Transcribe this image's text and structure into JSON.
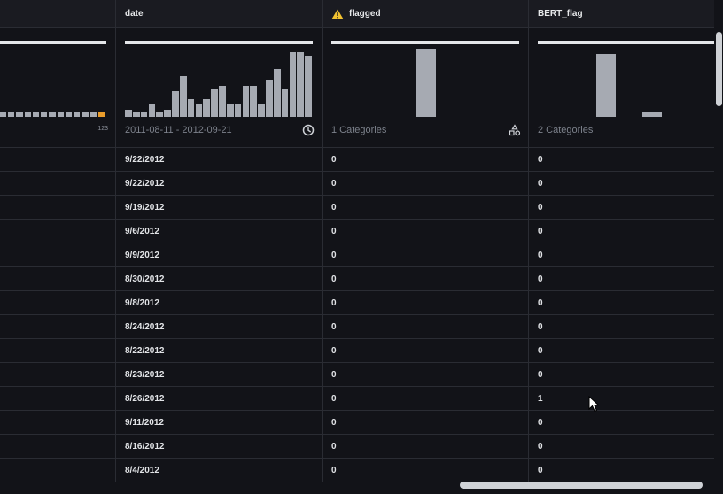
{
  "columns": [
    {
      "key": "prev",
      "header": "",
      "summary": {
        "caption": "",
        "small_caption": "123"
      },
      "cells": [
        "",
        "",
        "",
        "",
        "",
        "",
        "",
        "",
        "",
        "",
        "",
        "",
        "",
        ""
      ]
    },
    {
      "key": "date",
      "header": "date",
      "summary": {
        "caption": "2011-08-11 - 2012-09-21",
        "icon": "clock-icon"
      },
      "cells": [
        "9/22/2012",
        "9/22/2012",
        "9/19/2012",
        "9/6/2012",
        "9/9/2012",
        "8/30/2012",
        "9/8/2012",
        "8/24/2012",
        "8/22/2012",
        "8/23/2012",
        "8/26/2012",
        "9/11/2012",
        "8/16/2012",
        "8/4/2012"
      ]
    },
    {
      "key": "flagged",
      "header": "flagged",
      "header_icon": "warning-icon",
      "summary": {
        "caption": "1 Categories",
        "icon": "categories-icon"
      },
      "cells": [
        "0",
        "0",
        "0",
        "0",
        "0",
        "0",
        "0",
        "0",
        "0",
        "0",
        "0",
        "0",
        "0",
        "0"
      ]
    },
    {
      "key": "bert_flag",
      "header": "BERT_flag",
      "summary": {
        "caption": "2 Categories"
      },
      "cells": [
        "0",
        "0",
        "0",
        "0",
        "0",
        "0",
        "0",
        "0",
        "0",
        "0",
        "1",
        "0",
        "0",
        "0"
      ]
    }
  ],
  "histograms": {
    "prev": {
      "values": [
        0.08,
        0.08,
        0.08,
        0.08,
        0.08,
        0.08,
        0.08,
        0.08,
        0.08,
        0.08,
        0.08,
        0.08,
        0.08
      ],
      "highlight_index": 12
    },
    "date": {
      "values": [
        0.1,
        0.08,
        0.08,
        0.18,
        0.08,
        0.1,
        0.38,
        0.6,
        0.26,
        0.2,
        0.26,
        0.42,
        0.45,
        0.18,
        0.18,
        0.45,
        0.45,
        0.2,
        0.55,
        0.7,
        0.4,
        0.95,
        0.95,
        0.9
      ]
    },
    "flagged": {
      "values": [
        1.0
      ]
    },
    "bert_flag": {
      "values": [
        0.92,
        0.07
      ]
    }
  },
  "colors": {
    "accent_orange": "#e99c2b",
    "warning_yellow": "#f2c230",
    "bar_gray": "#a6aab2"
  }
}
